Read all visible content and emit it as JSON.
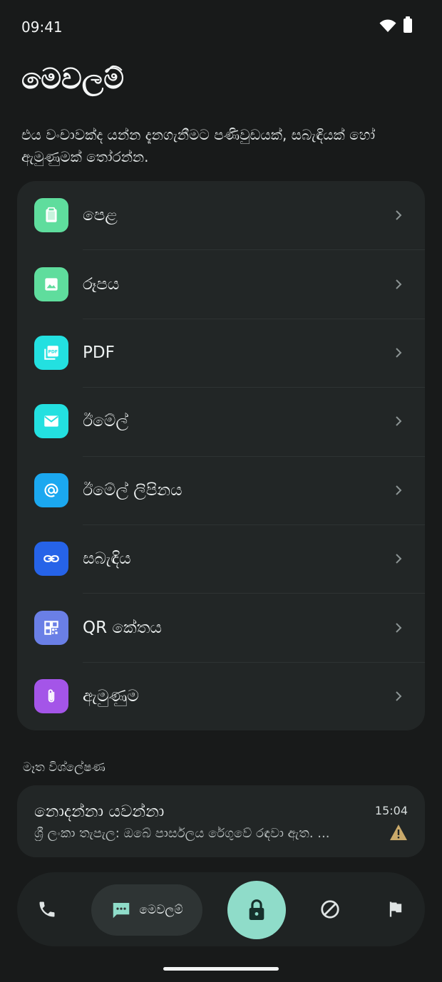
{
  "status_bar": {
    "time": "09:41"
  },
  "page": {
    "title": "මෙවලම්",
    "description": "එය වංචාවක්ද යන්න දැනගැනීමට පණිවුඩයක්, සබැඳියක් හෝ ඇමුණුමක් තෝරන්න."
  },
  "tools": [
    {
      "label": "පෙළ",
      "icon": "clipboard-icon",
      "color": "#5fdd9d"
    },
    {
      "label": "රූපය",
      "icon": "image-icon",
      "color": "#5fdd9d"
    },
    {
      "label": "PDF",
      "icon": "pdf-icon",
      "color": "#23e0e0"
    },
    {
      "label": "ඊමේල්",
      "icon": "mail-icon",
      "color": "#23e0e0"
    },
    {
      "label": "ඊමේල් ලිපිනය",
      "icon": "at-sign-icon",
      "color": "#1ba8f0"
    },
    {
      "label": "සබැඳිය",
      "icon": "link-icon",
      "color": "#2663e8"
    },
    {
      "label": "QR කේතය",
      "icon": "qr-code-icon",
      "color": "#6a7fe6"
    },
    {
      "label": "ඇමුණුම",
      "icon": "paperclip-icon",
      "color": "#a455e8"
    }
  ],
  "recent": {
    "header": "මෑත විශ්ලේෂණ",
    "message": {
      "sender": "නොදන්නා යවන්නා",
      "preview": "ශ්‍රී ලංකා තැපැල: ඔබේ පාර්සලය රේගුවේ රඳවා ඇත. ...",
      "time": "15:04",
      "status_icon": "warning-icon",
      "status_color": "#c9a96a"
    }
  },
  "bottom_nav": {
    "messages_label": "මෙවලම්",
    "accent": "#8fdcc9"
  }
}
